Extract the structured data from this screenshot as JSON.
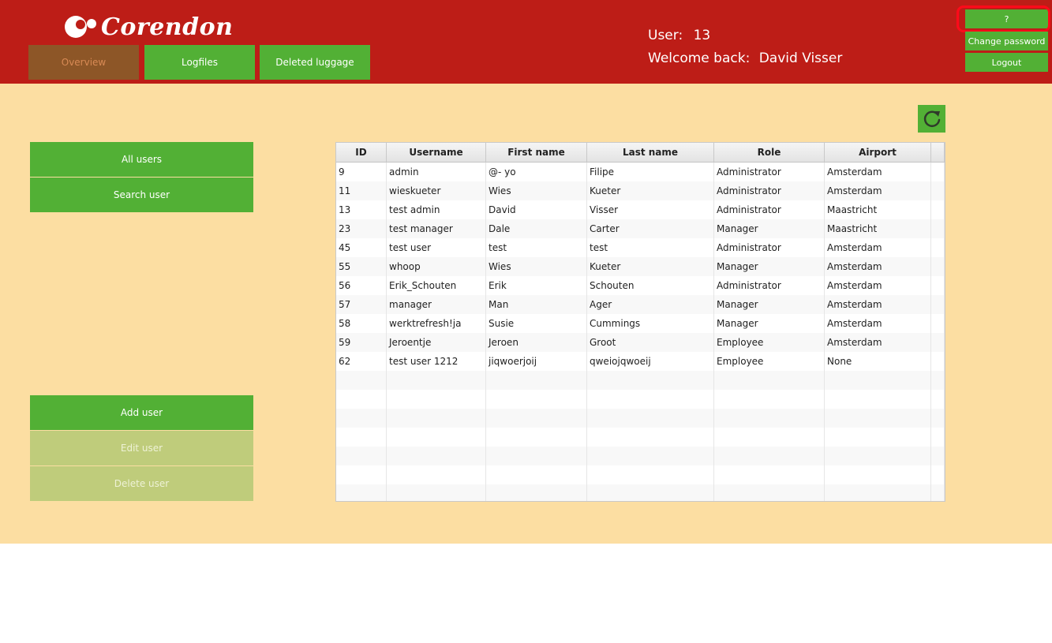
{
  "header": {
    "logo_text": "Corendon",
    "nav": [
      "Overview",
      "Logfiles",
      "Deleted luggage"
    ],
    "user_label": "User:",
    "user_id": "13",
    "welcome_label": "Welcome back:",
    "user_name": "David Visser",
    "help_label": "?",
    "change_password_label": "Change password",
    "logout_label": "Logout"
  },
  "colors": {
    "header_bg": "#bd1d17",
    "content_bg": "#fcdea2",
    "button_green": "#52b035",
    "button_disabled": "#bfcc7b",
    "active_tab": "#8d5627",
    "highlight": "#ff0a1a"
  },
  "sidebar": {
    "all_users": "All users",
    "search_user": "Search user",
    "add_user": "Add user",
    "edit_user": "Edit user",
    "delete_user": "Delete user"
  },
  "refresh_icon": "refresh-icon",
  "table": {
    "columns": [
      "ID",
      "Username",
      "First name",
      "Last name",
      "Role",
      "Airport"
    ],
    "rows": [
      [
        "9",
        "admin",
        "@- yo",
        "Filipe",
        "Administrator",
        "Amsterdam"
      ],
      [
        "11",
        "wieskueter",
        "Wies",
        "Kueter",
        "Administrator",
        "Amsterdam"
      ],
      [
        "13",
        "test admin",
        "David",
        "Visser",
        "Administrator",
        "Maastricht"
      ],
      [
        "23",
        "test manager",
        "Dale",
        "Carter",
        "Manager",
        "Maastricht"
      ],
      [
        "45",
        "test user",
        "test",
        "test",
        "Administrator",
        "Amsterdam"
      ],
      [
        "55",
        "whoop",
        "Wies",
        "Kueter",
        "Manager",
        "Amsterdam"
      ],
      [
        "56",
        "Erik_Schouten",
        "Erik",
        "Schouten",
        "Administrator",
        "Amsterdam"
      ],
      [
        "57",
        "manager",
        "Man",
        "Ager",
        "Manager",
        "Amsterdam"
      ],
      [
        "58",
        "werktrefresh!ja",
        "Susie",
        "Cummings",
        "Manager",
        "Amsterdam"
      ],
      [
        "59",
        "Jeroentje",
        "Jeroen",
        "Groot",
        "Employee",
        "Amsterdam"
      ],
      [
        "62",
        "test user 1212",
        "jiqwoerjoij",
        "qweiojqwoeij",
        "Employee",
        "None"
      ]
    ],
    "empty_rows": 7
  }
}
